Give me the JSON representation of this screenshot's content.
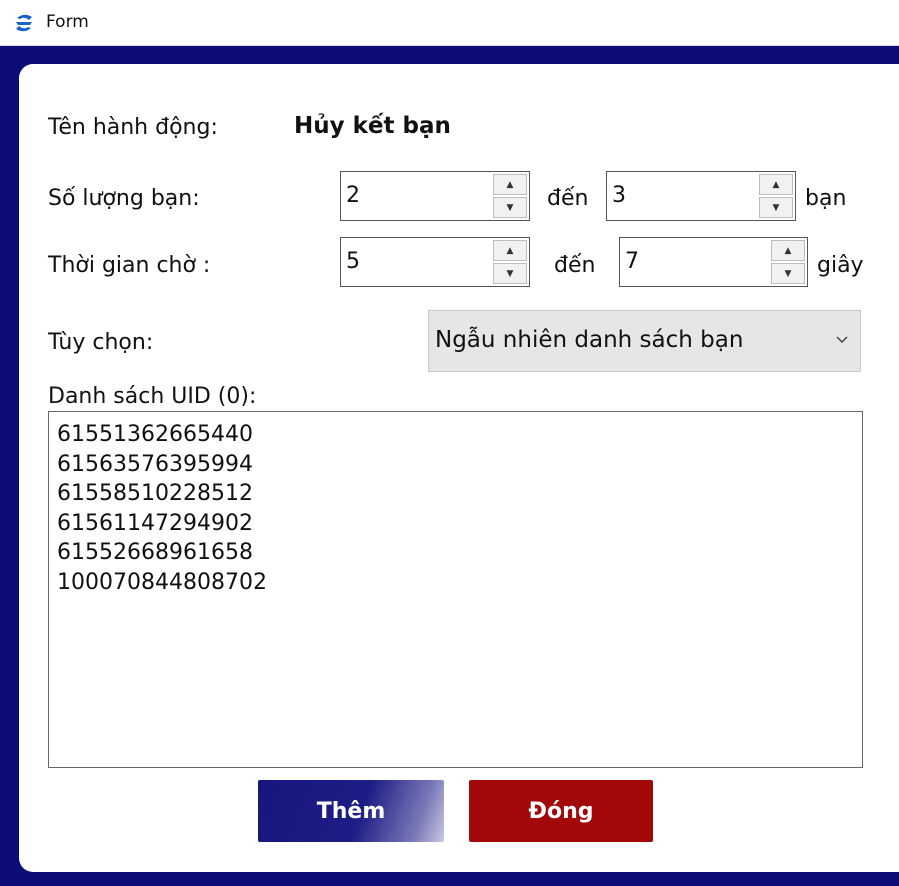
{
  "window": {
    "title": "Form",
    "icon": "app-logo-icon"
  },
  "form": {
    "action_label": "Tên hành động:",
    "action_value": "Hủy kết bạn",
    "friends": {
      "label": "Số lượng bạn:",
      "min": "2",
      "to": "đến",
      "max": "3",
      "unit": "bạn"
    },
    "wait": {
      "label": "Thời gian chờ :",
      "min": "5",
      "to": "đến",
      "max": "7",
      "unit": "giây"
    },
    "option": {
      "label": "Tùy chọn:",
      "selected": "Ngẫu nhiên danh sách bạn"
    },
    "uid_list": {
      "label": "Danh sách UID (0):",
      "lines": [
        "61551362665440",
        "61563576395994",
        "61558510228512",
        "61561147294902",
        "61552668961658",
        "100070844808702"
      ]
    }
  },
  "buttons": {
    "add": "Thêm",
    "close": "Đóng"
  },
  "colors": {
    "frame": "#0d0d7a",
    "add_button": "#16167e",
    "close_button": "#a30808"
  }
}
